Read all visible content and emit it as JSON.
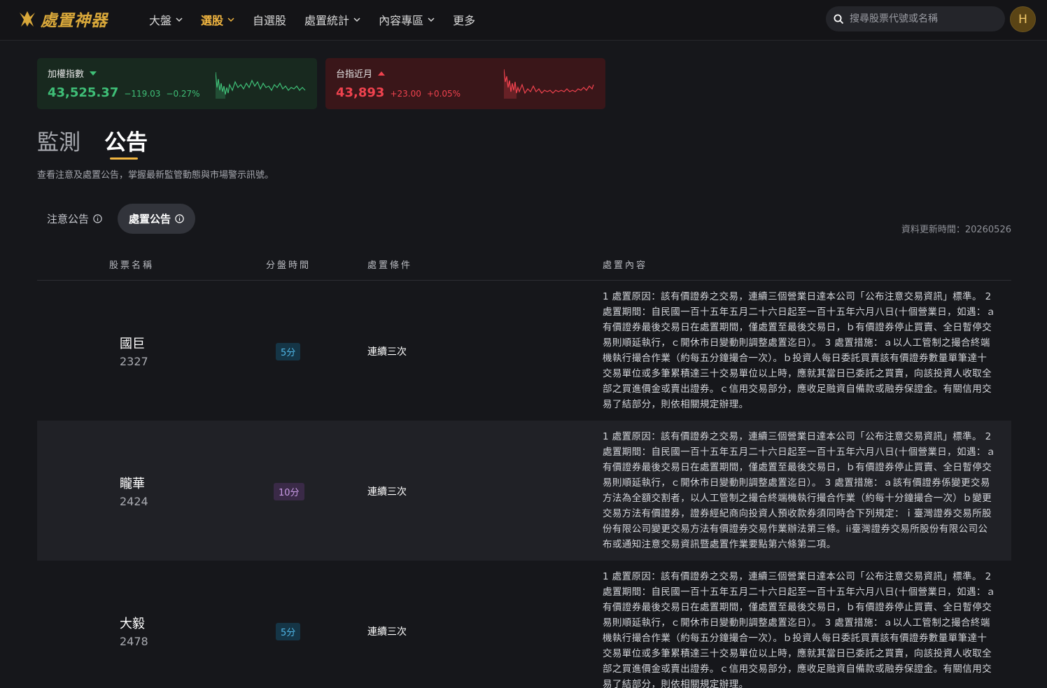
{
  "brand": {
    "name": "處置神器",
    "accent": "#f2b640"
  },
  "nav": {
    "items": [
      {
        "label": "大盤",
        "dropdown": true
      },
      {
        "label": "選股",
        "dropdown": true,
        "active": true
      },
      {
        "label": "自選股",
        "dropdown": false
      },
      {
        "label": "處置統計",
        "dropdown": true
      },
      {
        "label": "內容專區",
        "dropdown": true
      },
      {
        "label": "更多",
        "dropdown": false
      }
    ],
    "search_placeholder": "搜尋股票代號或名稱",
    "avatar_initial": "H"
  },
  "indices": {
    "taiex": {
      "name": "加權指數",
      "value": "43,525.37",
      "change": "−119.03",
      "percent": "−0.27%",
      "direction": "down",
      "color": "#3fbf77"
    },
    "futures": {
      "name": "台指近月",
      "value": "43,893",
      "change": "+23.00",
      "percent": "+0.05%",
      "direction": "up",
      "color": "#f0424e"
    }
  },
  "page": {
    "tabs": [
      "監測",
      "公告"
    ],
    "active_tab": "公告",
    "subtitle": "查看注意及處置公告，掌握最新監管動態與市場警示訊號。",
    "subtabs": [
      "注意公告",
      "處置公告"
    ],
    "active_subtab": "處置公告",
    "updated": "資料更新時間：20260526"
  },
  "table": {
    "headers": [
      "股票名稱",
      "分盤時間",
      "處置條件",
      "處置內容"
    ],
    "rows": [
      {
        "name": "國巨",
        "code": "2327",
        "interval": "5分",
        "interval_color": "blue",
        "condition": "連續三次",
        "content": "1 處置原因：該有價證券之交易，連續三個營業日達本公司「公布注意交易資訊」標準。 2 處置期間：自民國一百十五年五月二十六日起至一百十五年六月八日(十個營業日，如遇：ａ有價證券最後交易日在處置期間，僅處置至最後交易日，ｂ有價證券停止買賣、全日暫停交易則順延執行，ｃ開休市日變動則調整處置迄日）。 3 處置措施：ａ以人工管制之撮合終端機執行撮合作業（約每五分鐘撮合一次）。ｂ投資人每日委託買賣該有價證券數量單筆達十交易單位或多筆累積達三十交易單位以上時，應就其當日已委託之買賣，向該投資人收取全部之買進價金或賣出證券。ｃ信用交易部分，應收足融資自備款或融券保證金。有關信用交易了結部分，則依相關規定辦理。"
      },
      {
        "name": "矓華",
        "code": "2424",
        "interval": "10分",
        "interval_color": "purple",
        "condition": "連續三次",
        "content": "1 處置原因：該有價證券之交易，連續三個營業日達本公司「公布注意交易資訊」標準。 2 處置期間：自民國一百十五年五月二十六日起至一百十五年六月八日(十個營業日，如遇：ａ有價證券最後交易日在處置期間，僅處置至最後交易日，ｂ有價證券停止買賣、全日暫停交易則順延執行，ｃ開休市日變動則調整處置迄日）。 3 處置措施：ａ該有價證券係變更交易方法為全額交割者，以人工管制之撮合終端機執行撮合作業（約每十分鐘撮合一次）ｂ變更交易方法有價證券，證券經紀商向投資人預收款券須同時合下列規定：ｉ臺灣證券交易所股份有限公司變更交易方法有價證券交易作業辦法第三條。ii臺灣證券交易所股份有限公司公布或通知注意交易資訊暨處置作業要點第六條第二項。"
      },
      {
        "name": "大毅",
        "code": "2478",
        "interval": "5分",
        "interval_color": "blue",
        "condition": "連續三次",
        "content": "1 處置原因：該有價證券之交易，連續三個營業日達本公司「公布注意交易資訊」標準。 2 處置期間：自民國一百十五年五月二十六日起至一百十五年六月八日(十個營業日，如遇：ａ有價證券最後交易日在處置期間，僅處置至最後交易日，ｂ有價證券停止買賣、全日暫停交易則順延執行，ｃ開休市日變動則調整處置迄日）。 3 處置措施：ａ以人工管制之撮合終端機執行撮合作業（約每五分鐘撮合一次）。ｂ投資人每日委託買賣該有價證券數量單筆達十交易單位或多筆累積達三十交易單位以上時，應就其當日已委託之買賣，向該投資人收取全部之買進價金或賣出證券。ｃ信用交易部分，應收足融資自備款或融券保證金。有關信用交易了結部分，則依相關規定辦理。"
      }
    ]
  }
}
